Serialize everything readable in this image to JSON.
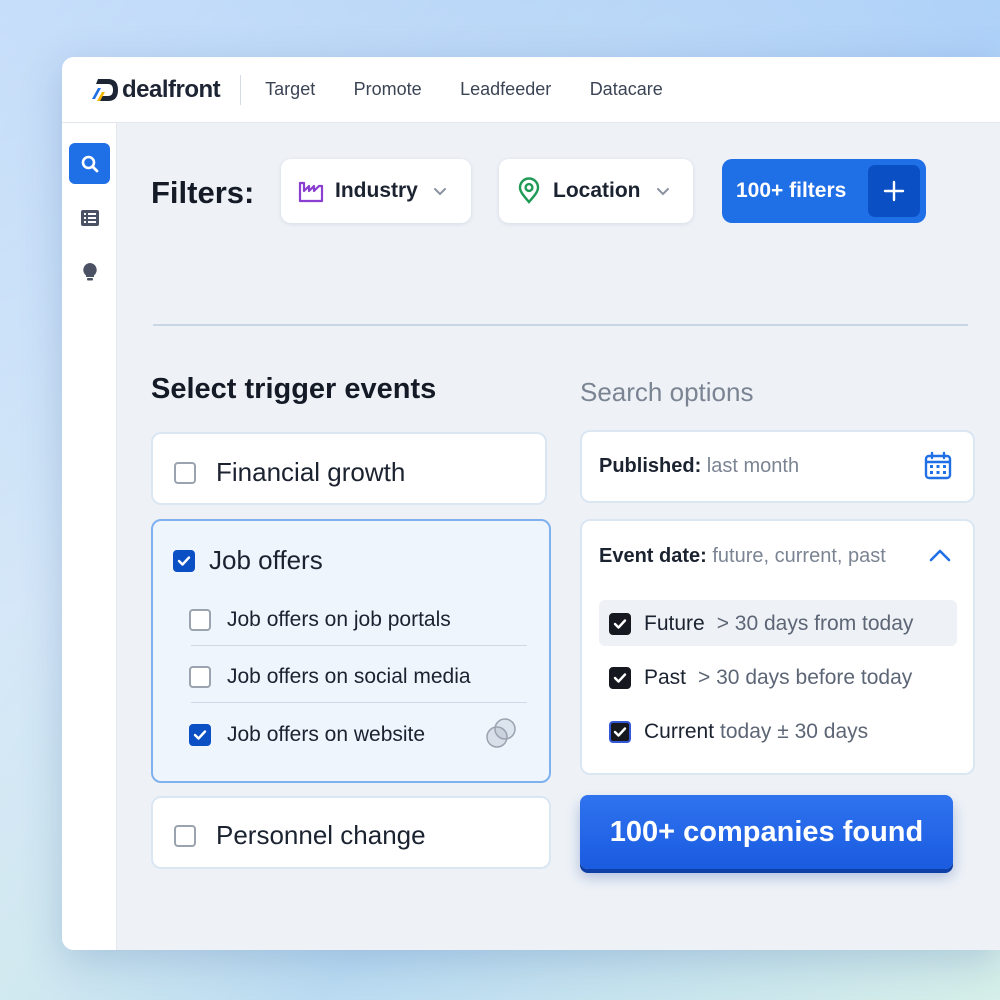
{
  "brand": {
    "logo_text": "dealfront"
  },
  "nav": [
    "Target",
    "Promote",
    "Leadfeeder",
    "Datacare"
  ],
  "sidebar": {
    "items": [
      "search-icon",
      "list-icon",
      "lightbulb-icon"
    ]
  },
  "filters": {
    "label": "Filters:",
    "industry": "Industry",
    "location": "Location",
    "more": "100+ filters"
  },
  "trigger_events": {
    "title": "Select trigger events",
    "financial_growth": {
      "label": "Financial growth",
      "checked": false
    },
    "job_offers": {
      "label": "Job offers",
      "checked": true,
      "sub": [
        {
          "label": "Job offers on job portals",
          "checked": false
        },
        {
          "label": "Job offers on social media",
          "checked": false
        },
        {
          "label": "Job offers on website",
          "checked": true
        }
      ]
    },
    "personnel_change": {
      "label": "Personnel change",
      "checked": false
    }
  },
  "search_options": {
    "title": "Search options",
    "published": {
      "key": "Published:",
      "value": "last month"
    },
    "event_date": {
      "key": "Event date:",
      "value": "future, current, past",
      "options": [
        {
          "name": "Future",
          "detail": "> 30 days from today",
          "checked": true
        },
        {
          "name": "Past",
          "detail": "> 30 days before today",
          "checked": true
        },
        {
          "name": "Current",
          "detail": "today ± 30 days",
          "checked": true
        }
      ]
    }
  },
  "cta": "100+ companies found",
  "colors": {
    "accent": "#1f6fe6",
    "accent_dark": "#0b4fc4",
    "industry_icon": "#8a3fd1",
    "location_icon": "#1f9a57"
  }
}
